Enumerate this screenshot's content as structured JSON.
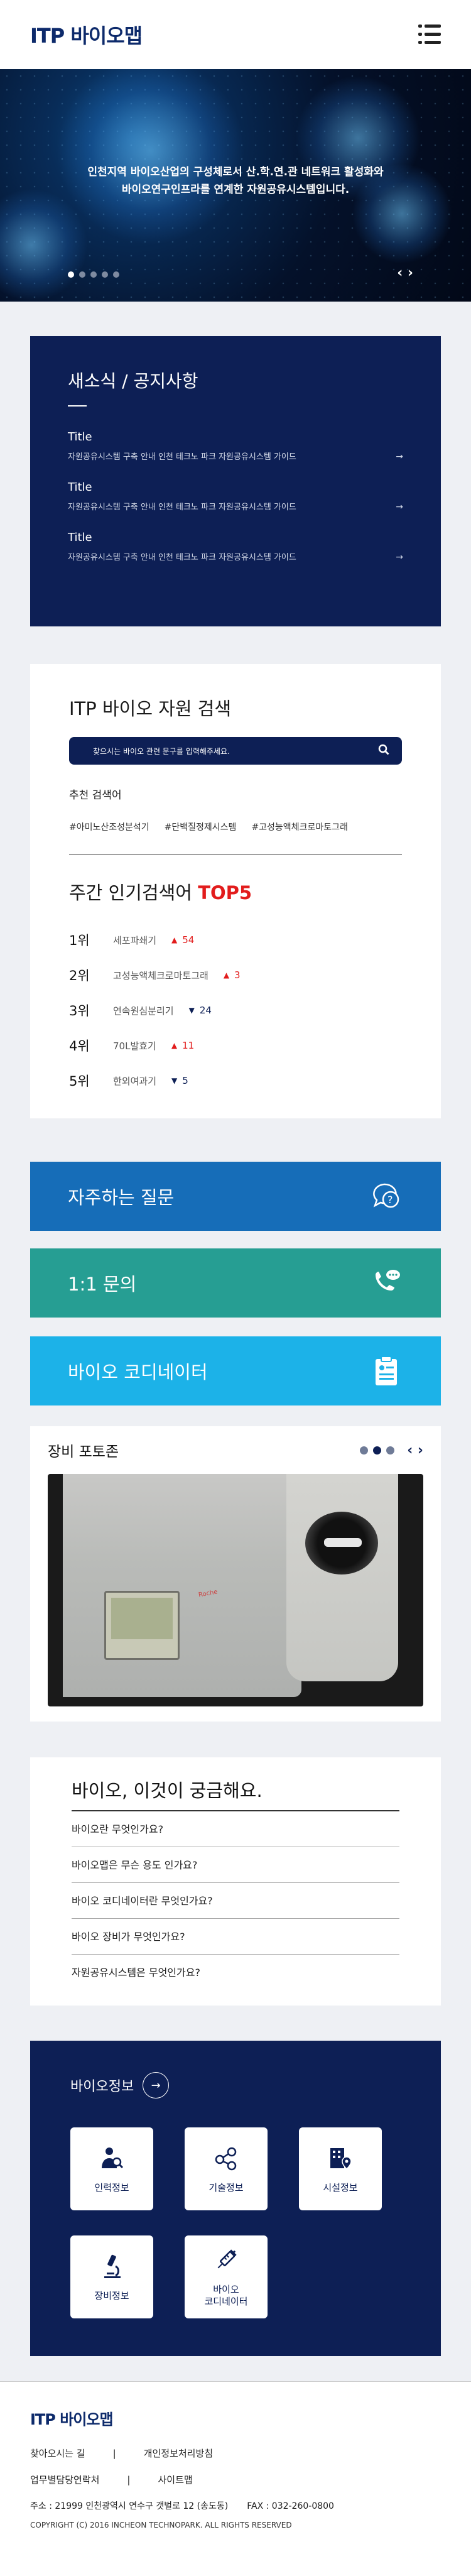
{
  "header": {
    "logo": "ITP 바이오맵",
    "menu_icon": "hamburger-menu-icon"
  },
  "hero": {
    "line1": "인천지역 바이오산업의 구성체로서 산.학.연.관 네트워크 활성화와",
    "line2": "바이오연구인프라를 연계한 자원공유시스템입니다.",
    "slide_count": 5,
    "active_slide": 1,
    "arrows": "‹ ›"
  },
  "news": {
    "title": "새소식 / 공지사항",
    "items": [
      {
        "title": "Title",
        "desc": "자원공유시스템 구축 안내 인천 테크노 파크 자원공유시스템 가이드"
      },
      {
        "title": "Title",
        "desc": "자원공유시스템 구축 안내 인천 테크노 파크 자원공유시스템 가이드"
      },
      {
        "title": "Title",
        "desc": "자원공유시스템 구축 안내 인천 테크노 파크 자원공유시스템 가이드"
      }
    ],
    "arrow": "→"
  },
  "search": {
    "title": "ITP 바이오 자원 검색",
    "placeholder": "찾으시는 바이오 관련 문구를 입력해주세요.",
    "rec_label": "추천 검색어",
    "tags": [
      "#아미노산조성분석기",
      "#단백질정제시스템",
      "#고성능액체크로마토그래"
    ],
    "weekly_title": "주간 인기검색어",
    "weekly_highlight": "TOP5",
    "ranks": [
      {
        "no": "1위",
        "kw": "세포파쇄기",
        "dir": "up",
        "tri": "▲",
        "count": "54"
      },
      {
        "no": "2위",
        "kw": "고성능액체크로마토그래",
        "dir": "up",
        "tri": "▲",
        "count": "3"
      },
      {
        "no": "3위",
        "kw": "연속원심분리기",
        "dir": "down",
        "tri": "▼",
        "count": "24"
      },
      {
        "no": "4위",
        "kw": "70L발효기",
        "dir": "up",
        "tri": "▲",
        "count": "11"
      },
      {
        "no": "5위",
        "kw": "한외여과기",
        "dir": "down",
        "tri": "▼",
        "count": "5"
      }
    ]
  },
  "quick": {
    "faq": "자주하는 질문",
    "inquiry": "1:1 문의",
    "coordinator": "바이오 코디네이터"
  },
  "photo": {
    "title": "장비 포토존",
    "slide_count": 3,
    "active_slide": 2,
    "arrows": "‹ ›",
    "brand": "Roche"
  },
  "bio_faq": {
    "title": "바이오, 이것이 궁금해요.",
    "questions": [
      "바이오란 무엇인가요?",
      "바이오맵은 무슨 용도 인가요?",
      "바이오 코디네이터란 무엇인가요?",
      "바이오 장비가 무엇인가요?",
      "자원공유시스템은 무엇인가요?"
    ]
  },
  "bio_info": {
    "title": "바이오정보",
    "tiles": [
      {
        "label": "인력정보",
        "icon": "person-search-icon"
      },
      {
        "label": "기술정보",
        "icon": "molecule-icon"
      },
      {
        "label": "시설정보",
        "icon": "building-location-icon"
      },
      {
        "label": "장비정보",
        "icon": "microscope-icon"
      },
      {
        "label": "바이오\n코디네이터",
        "icon": "syringe-icon"
      }
    ]
  },
  "footer": {
    "logo": "ITP 바이오맵",
    "link1": "찾아오시는 길",
    "link2": "개인정보처리방침",
    "link3": "업무별담당연락처",
    "link4": "사이트맵",
    "separator": "|",
    "address": "주소 : 21999 인천광역시 연수구 갯벌로 12 (송도동)",
    "fax": "FAX : 032-260-0800",
    "copyright": "COPYRIGHT (C) 2016 INCHEON TECHNOPARK. ALL RIGHTS RESERVED"
  }
}
